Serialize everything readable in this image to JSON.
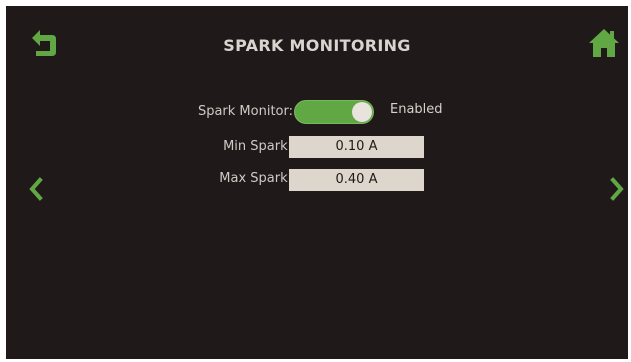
{
  "header": {
    "title": "SPARK MONITORING"
  },
  "icons": {
    "back": "back-arrow-icon",
    "home": "home-icon",
    "prev": "chevron-left-icon",
    "next": "chevron-right-icon"
  },
  "colors": {
    "background": "#1f1a19",
    "accent_green": "#61a845",
    "text": "#d9d4cf",
    "field_bg": "#ddd6cc"
  },
  "settings": {
    "spark_monitor": {
      "label": "Spark Monitor:",
      "enabled": true,
      "status": "Enabled"
    },
    "min_spark": {
      "label": "Min Spark:",
      "value": "0.10 A"
    },
    "max_spark": {
      "label": "Max Spark:",
      "value": "0.40 A"
    }
  }
}
